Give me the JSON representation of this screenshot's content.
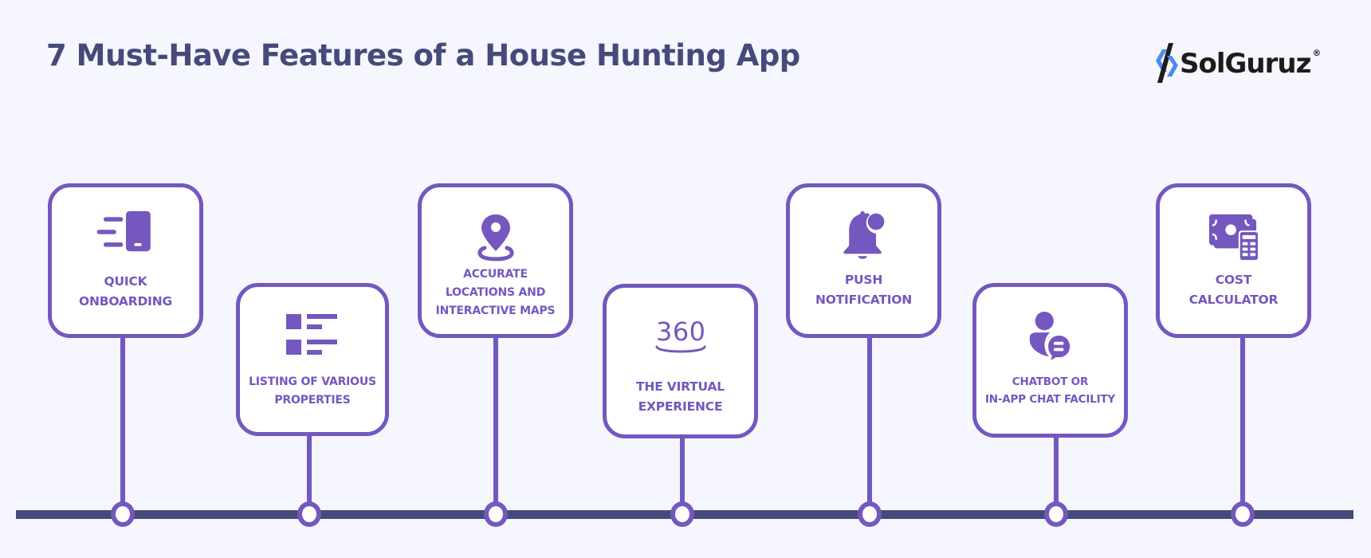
{
  "header": {
    "title": "7 Must-Have Features of a House Hunting App"
  },
  "logo": {
    "brand": "SolGuruz",
    "registered": "®",
    "accent_color": "#4a8cf7",
    "dark_color": "#1c1c1c"
  },
  "colors": {
    "background": "#f5f6fe",
    "title": "#454a7a",
    "accent": "#7457bf",
    "timeline": "#454a7a",
    "card_fill": "#ffffff"
  },
  "features": [
    {
      "label": "QUICK\nONBOARDING",
      "icon": "mobile-onboarding-icon",
      "row": "top"
    },
    {
      "label": "LISTING OF VARIOUS\nPROPERTIES",
      "icon": "list-icon",
      "row": "bottom"
    },
    {
      "label": "ACCURATE\nLOCATIONS AND\nINTERACTIVE MAPS",
      "icon": "map-pin-icon",
      "row": "top"
    },
    {
      "label": "THE VIRTUAL\nEXPERIENCE",
      "icon": "360-view-icon",
      "row": "bottom"
    },
    {
      "label": "PUSH\nNOTIFICATION",
      "icon": "bell-notification-icon",
      "row": "top"
    },
    {
      "label": "CHATBOT OR\nIN-APP CHAT FACILITY",
      "icon": "user-chat-icon",
      "row": "bottom"
    },
    {
      "label": "COST\nCALCULATOR",
      "icon": "money-calculator-icon",
      "row": "top"
    }
  ]
}
